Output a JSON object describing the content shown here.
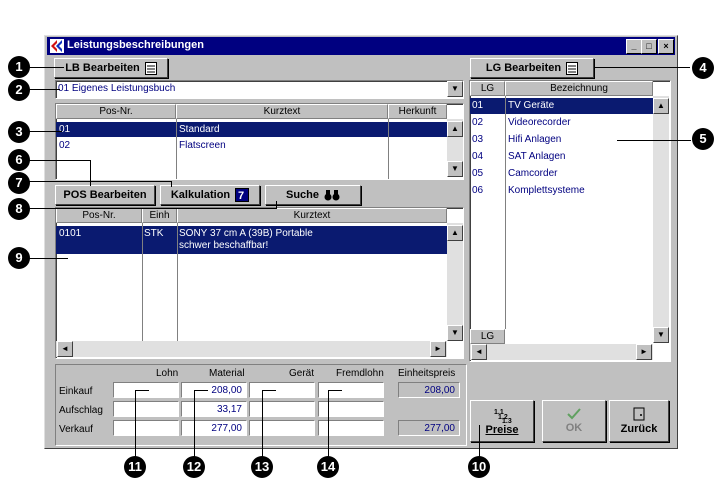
{
  "window": {
    "title": "Leistungsbeschreibungen",
    "min": "_",
    "max": "□",
    "close": "×"
  },
  "lb": {
    "button": "LB Bearbeiten",
    "combo_value": "01   Eigenes Leistungsbuch",
    "table_headers": [
      "Pos-Nr.",
      "Kurztext",
      "Herkunft"
    ],
    "rows": [
      {
        "nr": "01",
        "text": "Standard",
        "herkunft": ""
      },
      {
        "nr": "02",
        "text": "Flatscreen",
        "herkunft": ""
      }
    ]
  },
  "pos": {
    "button": "POS Bearbeiten",
    "kalkulation": "Kalkulation",
    "suche": "Suche",
    "table_headers": [
      "Pos-Nr.",
      "Einh",
      "Kurztext"
    ],
    "rows": [
      {
        "nr": "0101",
        "einh": "STK",
        "line1": "SONY 37 cm A (39B) Portable",
        "line2": "schwer beschaffbar!"
      }
    ]
  },
  "lg": {
    "button": "LG Bearbeiten",
    "table_headers": [
      "LG",
      "Bezeichnung"
    ],
    "rows": [
      {
        "lg": "01",
        "bez": "TV Geräte"
      },
      {
        "lg": "02",
        "bez": "Videorecorder"
      },
      {
        "lg": "03",
        "bez": "Hifi Anlagen"
      },
      {
        "lg": "04",
        "bez": "SAT Anlagen"
      },
      {
        "lg": "05",
        "bez": "Camcorder"
      },
      {
        "lg": "06",
        "bez": "Komplettsysteme"
      }
    ],
    "footer_header": "LG"
  },
  "prices": {
    "col_headers": [
      "Lohn",
      "Material",
      "Gerät",
      "Fremdlohn",
      "Einheitspreis"
    ],
    "row_labels": [
      "Einkauf",
      "Aufschlag",
      "Verkauf"
    ],
    "material": [
      "208,00",
      "33,17",
      "277,00"
    ],
    "einheitspreis": [
      "208,00",
      "277,00"
    ]
  },
  "buttons": {
    "preise": "Preise",
    "ok": "OK",
    "zurueck": "Zurück"
  },
  "callouts": [
    "1",
    "2",
    "3",
    "4",
    "5",
    "6",
    "7",
    "8",
    "9",
    "10",
    "11",
    "12",
    "13",
    "14"
  ]
}
